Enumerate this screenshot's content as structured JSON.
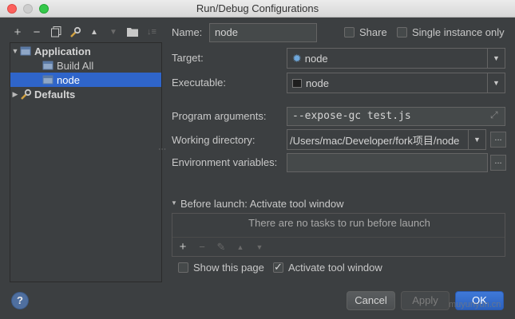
{
  "window": {
    "title": "Run/Debug Configurations"
  },
  "toolbar": {
    "buttons": [
      {
        "name": "add-icon",
        "glyph": "+"
      },
      {
        "name": "remove-icon",
        "glyph": "−"
      },
      {
        "name": "copy-icon",
        "glyph": "⧉"
      },
      {
        "name": "wrench-icon",
        "glyph": "✲"
      },
      {
        "name": "move-up-icon",
        "glyph": "▲"
      },
      {
        "name": "move-down-icon",
        "glyph": "▼"
      },
      {
        "name": "folder-icon",
        "glyph": "■"
      },
      {
        "name": "sort-icon",
        "glyph": "↓"
      }
    ]
  },
  "tree": {
    "application": "Application",
    "build_all": "Build All",
    "node": "node",
    "defaults": "Defaults"
  },
  "form": {
    "name_label": "Name:",
    "name_value": "node",
    "share_label": "Share",
    "single_instance_label": "Single instance only",
    "target_label": "Target:",
    "target_value": "node",
    "executable_label": "Executable:",
    "executable_value": "node",
    "program_args_label": "Program arguments:",
    "program_args_value": "--expose-gc test.js",
    "working_dir_label": "Working directory:",
    "working_dir_value": "/Users/mac/Developer/fork项目/node",
    "env_vars_label": "Environment variables:",
    "env_vars_value": "",
    "ellipsis": "...",
    "expand_icon": "⤢"
  },
  "before_launch": {
    "heading": "Before launch: Activate tool window",
    "empty_message": "There are no tasks to run before launch",
    "show_page_label": "Show this page",
    "show_page_checked": false,
    "activate_tool_label": "Activate tool window",
    "activate_tool_checked": true
  },
  "buttons": {
    "help": "?",
    "cancel": "Cancel",
    "apply": "Apply",
    "ok": "OK"
  },
  "watermark": "muyunyun.cn",
  "colors": {
    "background": "#3c3f41",
    "selection": "#2f65ca",
    "primary_button": "#2c61bd"
  }
}
